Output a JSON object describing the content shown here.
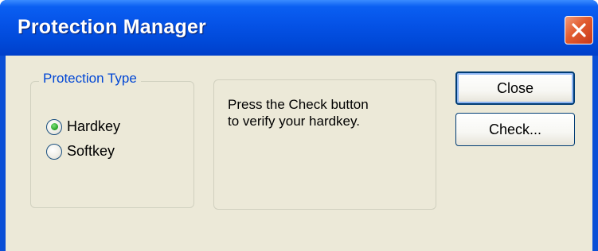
{
  "window": {
    "title": "Protection Manager",
    "close_icon": "close-x-icon"
  },
  "protection_type": {
    "legend": "Protection Type",
    "options": [
      {
        "label": "Hardkey",
        "selected": true
      },
      {
        "label": "Softkey",
        "selected": false
      }
    ]
  },
  "info": {
    "line1": "Press the Check button",
    "line2": "to verify your hardkey."
  },
  "buttons": {
    "close_label": "Close",
    "check_label": "Check..."
  },
  "colors": {
    "titlebar": "#0552e6",
    "legend_text": "#0046d5",
    "radio_selected": "#21a121",
    "dialog_face": "#ece9d8"
  }
}
